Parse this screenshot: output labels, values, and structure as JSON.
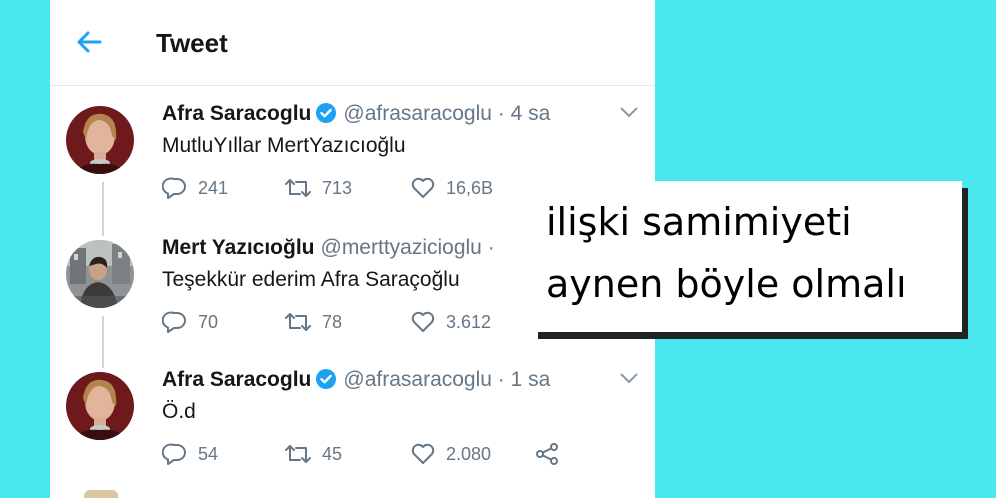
{
  "header": {
    "title": "Tweet",
    "back_icon": "arrow-left-icon"
  },
  "colors": {
    "accent": "#1da1f2",
    "background": "#4ce8ef",
    "muted": "#657786",
    "text": "#14171a"
  },
  "tweets": [
    {
      "name": "Afra Saracoglu",
      "verified": true,
      "handle": "@afrasaracoglu",
      "separator": "·",
      "time": "4 sa",
      "text": "MutluYıllar MertYazıcıoğlu",
      "replies": "241",
      "retweets": "713",
      "likes": "16,6B"
    },
    {
      "name": "Mert Yazıcıoğlu",
      "verified": false,
      "handle": "@merttyazicioglu",
      "separator": "·",
      "time": "",
      "text": "Teşekkür ederim Afra Saraçoğlu",
      "replies": "70",
      "retweets": "78",
      "likes": "3.612"
    },
    {
      "name": "Afra Saracoglu",
      "verified": true,
      "handle": "@afrasaracoglu",
      "separator": "·",
      "time": "1 sa",
      "text": "Ö.d",
      "replies": "54",
      "retweets": "45",
      "likes": "2.080"
    }
  ],
  "overlay": {
    "line1": "ilişki samimiyeti",
    "line2": "aynen böyle olmalı"
  }
}
